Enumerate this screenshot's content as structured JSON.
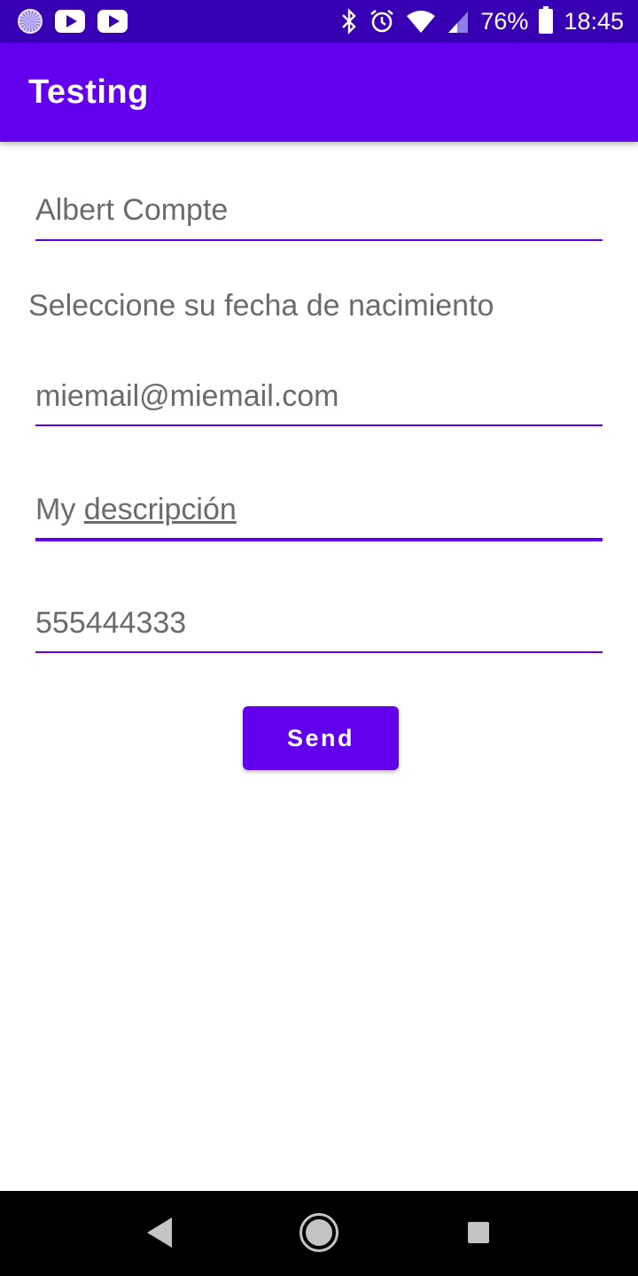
{
  "status_bar": {
    "battery_percent": "76%",
    "time": "18:45",
    "icons": [
      "spinner-icon",
      "youtube-icon",
      "youtube-icon",
      "bluetooth-icon",
      "alarm-icon",
      "wifi-icon",
      "signal-icon",
      "battery-charging-icon"
    ]
  },
  "app_bar": {
    "title": "Testing"
  },
  "form": {
    "name_value": "Albert Compte",
    "date_label": "Seleccione su fecha de nacimiento",
    "email_value": "miemail@miemail.com",
    "description_prefix": "My",
    "description_word": "descripción",
    "phone_value": "555444333",
    "send_label": "Send"
  },
  "nav_bar": {
    "icons": [
      "back-icon",
      "home-icon",
      "recents-icon"
    ]
  },
  "colors": {
    "status_bar": "#3700B3",
    "primary": "#6200EE",
    "text_secondary": "#6b6b6b"
  }
}
